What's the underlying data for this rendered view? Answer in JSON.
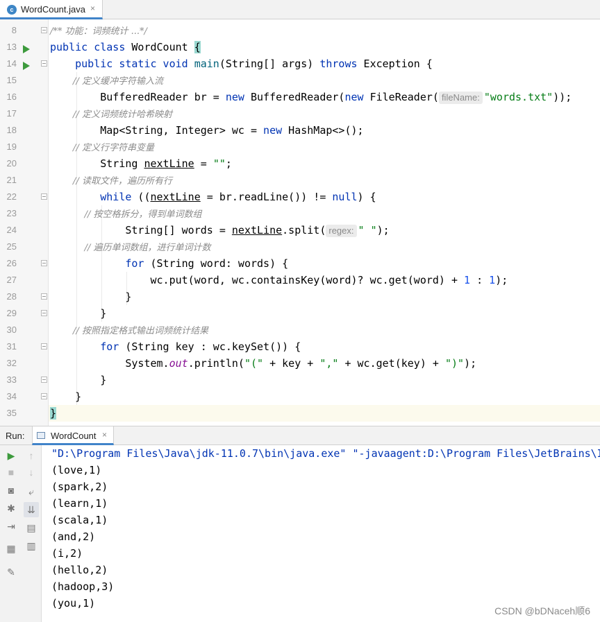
{
  "editor_tab": {
    "title": "WordCount.java",
    "close": "×",
    "file_icon": "c"
  },
  "gutter": {
    "line_numbers": [
      "8",
      "13",
      "14",
      "15",
      "16",
      "17",
      "18",
      "19",
      "20",
      "21",
      "22",
      "23",
      "24",
      "25",
      "26",
      "27",
      "28",
      "29",
      "30",
      "31",
      "32",
      "33",
      "34",
      "35"
    ]
  },
  "code": {
    "l8": "/** 功能：词频统计 ...*/",
    "l13_kw": "public class ",
    "l13_name": "WordCount ",
    "l13_brace": "{",
    "l14_kw1": "    public static void ",
    "l14_fn": "main",
    "l14_mid": "(String[] args) ",
    "l14_kw2": "throws",
    "l14_end": " Exception {",
    "l15": "        // 定义缓冲字符输入流",
    "l16_a": "        BufferedReader br = ",
    "l16_new1": "new",
    "l16_b": " BufferedReader(",
    "l16_new2": "new",
    "l16_c": " FileReader(",
    "l16_hint": "fileName:",
    "l16_str": "\"words.txt\"",
    "l16_d": "));",
    "l17": "        // 定义词频统计哈希映射",
    "l18_a": "        Map<String, Integer> wc = ",
    "l18_new": "new",
    "l18_b": " HashMap<>();",
    "l19": "        // 定义行字符串变量",
    "l20_a": "        String ",
    "l20_var": "nextLine",
    "l20_b": " = ",
    "l20_str": "\"\"",
    "l20_c": ";",
    "l21": "        // 读取文件，遍历所有行",
    "l22_kw": "        while",
    "l22_a": " ((",
    "l22_var": "nextLine",
    "l22_b": " = br.readLine()) != ",
    "l22_null": "null",
    "l22_c": ") {",
    "l23": "            // 按空格拆分，得到单词数组",
    "l24_a": "            String[] words = ",
    "l24_var": "nextLine",
    "l24_b": ".split(",
    "l24_hint": "regex:",
    "l24_str": "\" \"",
    "l24_c": ");",
    "l25": "            // 遍历单词数组，进行单词计数",
    "l26_kw": "            for",
    "l26_a": " (String word: words) {",
    "l27_a": "                wc.put(word, wc.containsKey(word)? wc.get(word) + ",
    "l27_n1": "1",
    "l27_b": " : ",
    "l27_n2": "1",
    "l27_c": ");",
    "l28": "            }",
    "l29": "        }",
    "l30": "        // 按照指定格式输出词频统计结果",
    "l31_kw": "        for",
    "l31_a": " (String key : wc.keySet()) {",
    "l32_a": "            System.",
    "l32_fld": "out",
    "l32_b": ".println(",
    "l32_s1": "\"(\"",
    "l32_c": " + key + ",
    "l32_s2": "\",\"",
    "l32_d": " + wc.get(key) + ",
    "l32_s3": "\")\"",
    "l32_e": ");",
    "l33": "        }",
    "l34": "    }",
    "l35": "}"
  },
  "run_window": {
    "label": "Run:",
    "tab_title": "WordCount",
    "tab_close": "×",
    "tools": [
      "play-icon",
      "stop-icon",
      "camera-icon",
      "settings-bug-icon",
      "exit-icon",
      "layout-icon",
      "pin-icon"
    ],
    "tools2": [
      "arrow-up-icon",
      "arrow-down-icon",
      "soft-wrap-icon",
      "scroll-to-end-icon",
      "print-icon",
      "trash-icon"
    ]
  },
  "console": {
    "command": "\"D:\\Program Files\\Java\\jdk-11.0.7\\bin\\java.exe\" \"-javaagent:D:\\Program Files\\JetBrains\\I",
    "lines": [
      "(love,1)",
      "(spark,2)",
      "(learn,1)",
      "(scala,1)",
      "(and,2)",
      "(i,2)",
      "(hello,2)",
      "(hadoop,3)",
      "(you,1)"
    ]
  },
  "watermark": "CSDN @bDNaceh顺6"
}
